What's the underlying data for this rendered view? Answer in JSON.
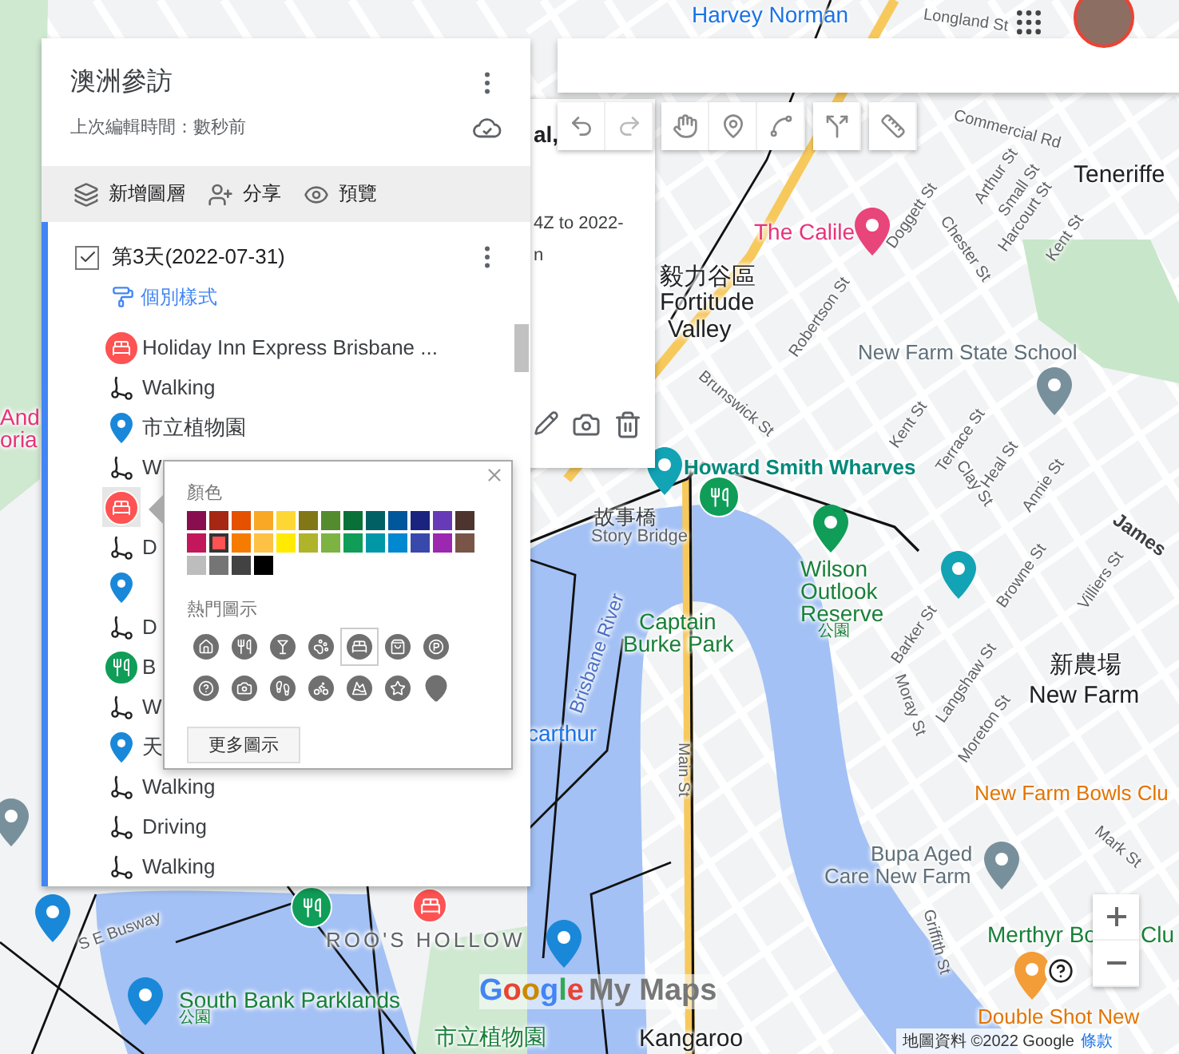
{
  "sidebar": {
    "title": "澳洲參訪",
    "subtitle": "上次編輯時間：數秒前",
    "actions": [
      {
        "kind": "layer",
        "label": "新增圖層"
      },
      {
        "kind": "share",
        "label": "分享"
      },
      {
        "kind": "preview",
        "label": "預覽"
      }
    ],
    "layer": {
      "title": "第3天(2022-07-31)",
      "checked": true,
      "style_link": "個別樣式",
      "items": [
        {
          "kind": "hotel",
          "text": "Holiday Inn Express Brisbane ...",
          "selected": false
        },
        {
          "kind": "route",
          "text": "Walking",
          "selected": false
        },
        {
          "kind": "place",
          "text": "市立植物園",
          "selected": false
        },
        {
          "kind": "route",
          "text": "W",
          "selected": false
        },
        {
          "kind": "hotel",
          "selected": true
        },
        {
          "kind": "route",
          "text": "D",
          "selected": false
        },
        {
          "kind": "place",
          "selected": false
        },
        {
          "kind": "route",
          "text": "D",
          "selected": false
        },
        {
          "kind": "restaurant",
          "text": "B",
          "selected": false
        },
        {
          "kind": "route",
          "text": "W",
          "selected": false
        },
        {
          "kind": "place",
          "text": "天",
          "selected": false
        },
        {
          "kind": "route",
          "text": "Walking",
          "selected": false
        },
        {
          "kind": "route",
          "text": "Driving",
          "selected": false
        },
        {
          "kind": "route",
          "text": "Walking",
          "selected": false
        }
      ]
    }
  },
  "style_popup": {
    "color_label": "顏色",
    "icon_label": "熱門圖示",
    "more_button": "更多圖示",
    "colors": [
      {
        "color": "#880e4f",
        "selected": false
      },
      {
        "color": "#a52714",
        "selected": false
      },
      {
        "color": "#e65100",
        "selected": false
      },
      {
        "color": "#f9a825",
        "selected": false
      },
      {
        "color": "#fdd835",
        "selected": false
      },
      {
        "color": "#817717",
        "selected": false
      },
      {
        "color": "#558b2f",
        "selected": false
      },
      {
        "color": "#097138",
        "selected": false
      },
      {
        "color": "#006064",
        "selected": false
      },
      {
        "color": "#01579b",
        "selected": false
      },
      {
        "color": "#1a237e",
        "selected": false
      },
      {
        "color": "#673ab7",
        "selected": false
      },
      {
        "color": "#4e342e",
        "selected": false
      },
      {
        "color": "#c2185b",
        "selected": false
      },
      {
        "color": "#ff5252",
        "selected": true
      },
      {
        "color": "#f57c00",
        "selected": false
      },
      {
        "color": "#ffc046",
        "selected": false
      },
      {
        "color": "#ffea00",
        "selected": false
      },
      {
        "color": "#afb42b",
        "selected": false
      },
      {
        "color": "#7cb342",
        "selected": false
      },
      {
        "color": "#0f9d58",
        "selected": false
      },
      {
        "color": "#0097a7",
        "selected": false
      },
      {
        "color": "#0288d1",
        "selected": false
      },
      {
        "color": "#3949ab",
        "selected": false
      },
      {
        "color": "#9c27b0",
        "selected": false
      },
      {
        "color": "#795548",
        "selected": false
      },
      {
        "color": "#bdbdbd",
        "selected": false
      },
      {
        "color": "#757575",
        "selected": false
      },
      {
        "color": "#424242",
        "selected": false
      },
      {
        "color": "#000000",
        "selected": false
      }
    ],
    "icons": [
      {
        "kind": "home",
        "selected": false
      },
      {
        "kind": "restaurant",
        "selected": false
      },
      {
        "kind": "bar",
        "selected": false
      },
      {
        "kind": "animal",
        "selected": false
      },
      {
        "kind": "hotel",
        "selected": true
      },
      {
        "kind": "shopping",
        "selected": false
      },
      {
        "kind": "parking",
        "selected": false
      },
      {
        "kind": "help",
        "selected": false
      },
      {
        "kind": "camera",
        "selected": false
      },
      {
        "kind": "hiking",
        "selected": false
      },
      {
        "kind": "cycling",
        "selected": false
      },
      {
        "kind": "skiing",
        "selected": false
      },
      {
        "kind": "star",
        "selected": false
      },
      {
        "kind": "pin",
        "selected": false
      }
    ]
  },
  "info_card": {
    "title": "al,",
    "lines": [
      "4Z to 2022-",
      "n"
    ]
  },
  "map": {
    "labels": [
      {
        "kind": "poi_blue",
        "text": "Harvey Norman"
      },
      {
        "kind": "street",
        "text": "Longland St"
      },
      {
        "kind": "street",
        "text": "Commercial Rd"
      },
      {
        "kind": "district",
        "text": "Teneriffe"
      },
      {
        "kind": "street",
        "text": "Doggett St"
      },
      {
        "kind": "street",
        "text": "Arthur St"
      },
      {
        "kind": "street",
        "text": "Small St"
      },
      {
        "kind": "street",
        "text": "Harcourt St"
      },
      {
        "kind": "street",
        "text": "Chester St"
      },
      {
        "kind": "street",
        "text": "Kent St"
      },
      {
        "kind": "poi_red",
        "text": "The Calile"
      },
      {
        "kind": "district",
        "text": "毅力谷區"
      },
      {
        "kind": "district",
        "text": "Fortitude"
      },
      {
        "kind": "district",
        "text": "Valley"
      },
      {
        "kind": "street",
        "text": "Robertson St"
      },
      {
        "kind": "street",
        "text": "Brunswick St"
      },
      {
        "kind": "poi_grey",
        "text": "New Farm State School"
      },
      {
        "kind": "street",
        "text": "Terrace St"
      },
      {
        "kind": "street",
        "text": "Heal St"
      },
      {
        "kind": "street",
        "text": "Kent St"
      },
      {
        "kind": "poi_teal",
        "text": "Howard Smith Wharves"
      },
      {
        "kind": "area",
        "text": "故事橋"
      },
      {
        "kind": "area_small",
        "text": "Story Bridge"
      },
      {
        "kind": "poi_green",
        "text": "Wilson"
      },
      {
        "kind": "poi_green",
        "text": "Outlook"
      },
      {
        "kind": "poi_green",
        "text": "Reserve"
      },
      {
        "kind": "poi_green_small",
        "text": "公園"
      },
      {
        "kind": "water",
        "text": "Brisbane River"
      },
      {
        "kind": "poi_green",
        "text": "Captain"
      },
      {
        "kind": "poi_green",
        "text": "Burke Park"
      },
      {
        "kind": "street",
        "text": "Main St"
      },
      {
        "kind": "street",
        "text": "Barker St"
      },
      {
        "kind": "street",
        "text": "Moray St"
      },
      {
        "kind": "street",
        "text": "Langshaw St"
      },
      {
        "kind": "street",
        "text": "Moreton St"
      },
      {
        "kind": "street",
        "text": "Browne St"
      },
      {
        "kind": "street",
        "text": "Villiers St"
      },
      {
        "kind": "street_bold",
        "text": "James"
      },
      {
        "kind": "street",
        "text": "Clay St"
      },
      {
        "kind": "street",
        "text": "Annie St"
      },
      {
        "kind": "district",
        "text": "新農場"
      },
      {
        "kind": "district",
        "text": "New Farm"
      },
      {
        "kind": "poi_orange",
        "text": "New Farm Bowls Clu"
      },
      {
        "kind": "street",
        "text": "Mark St"
      },
      {
        "kind": "poi_grey",
        "text": "Bupa Aged"
      },
      {
        "kind": "poi_grey",
        "text": "Care New Farm"
      },
      {
        "kind": "street",
        "text": "Griffith St"
      },
      {
        "kind": "poi_green",
        "text": "Merthyr Bo"
      },
      {
        "kind": "poi_green",
        "text": "Clu"
      },
      {
        "kind": "poi_orange",
        "text": "Double Shot New"
      },
      {
        "kind": "street",
        "text": "S E Busway"
      },
      {
        "kind": "poi_green",
        "text": "South Bank Parklands"
      },
      {
        "kind": "poi_green_small",
        "text": "公園"
      },
      {
        "kind": "caps",
        "text": "ROO'S HOLLOW"
      },
      {
        "kind": "poi_green",
        "text": "市立植物園"
      },
      {
        "kind": "district",
        "text": "Kangaroo"
      },
      {
        "kind": "poi_red",
        "text": "And"
      },
      {
        "kind": "poi_red",
        "text": "oria"
      },
      {
        "kind": "poi_blue",
        "text": "carthur"
      }
    ]
  },
  "logo": {
    "brand": "Google",
    "product": "My Maps"
  },
  "attribution": {
    "text": "地圖資料 ©2022 Google",
    "link": "條款"
  }
}
